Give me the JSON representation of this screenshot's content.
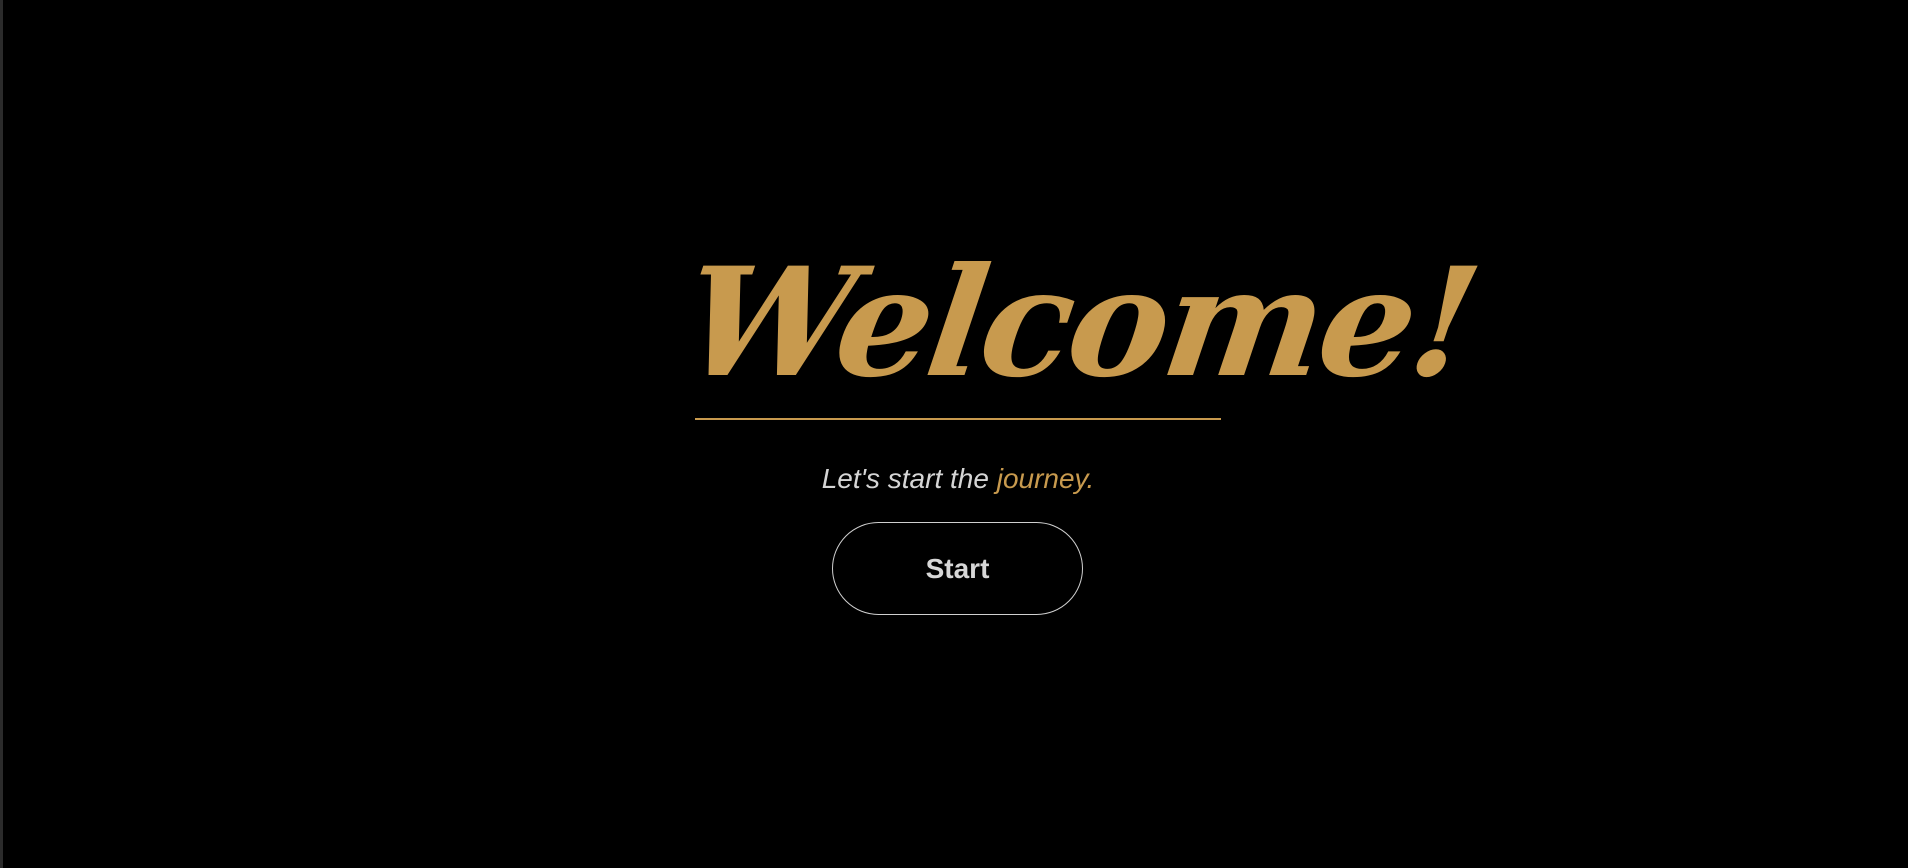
{
  "welcome": {
    "title": "Welcome!",
    "subtitle_prefix": "Let's start the ",
    "subtitle_accent": "journey.",
    "start_label": "Start"
  },
  "colors": {
    "background": "#000000",
    "accent_gold": "#c89a4e",
    "subtitle_text": "#d5d5d5",
    "button_border": "#d0d0d0"
  }
}
